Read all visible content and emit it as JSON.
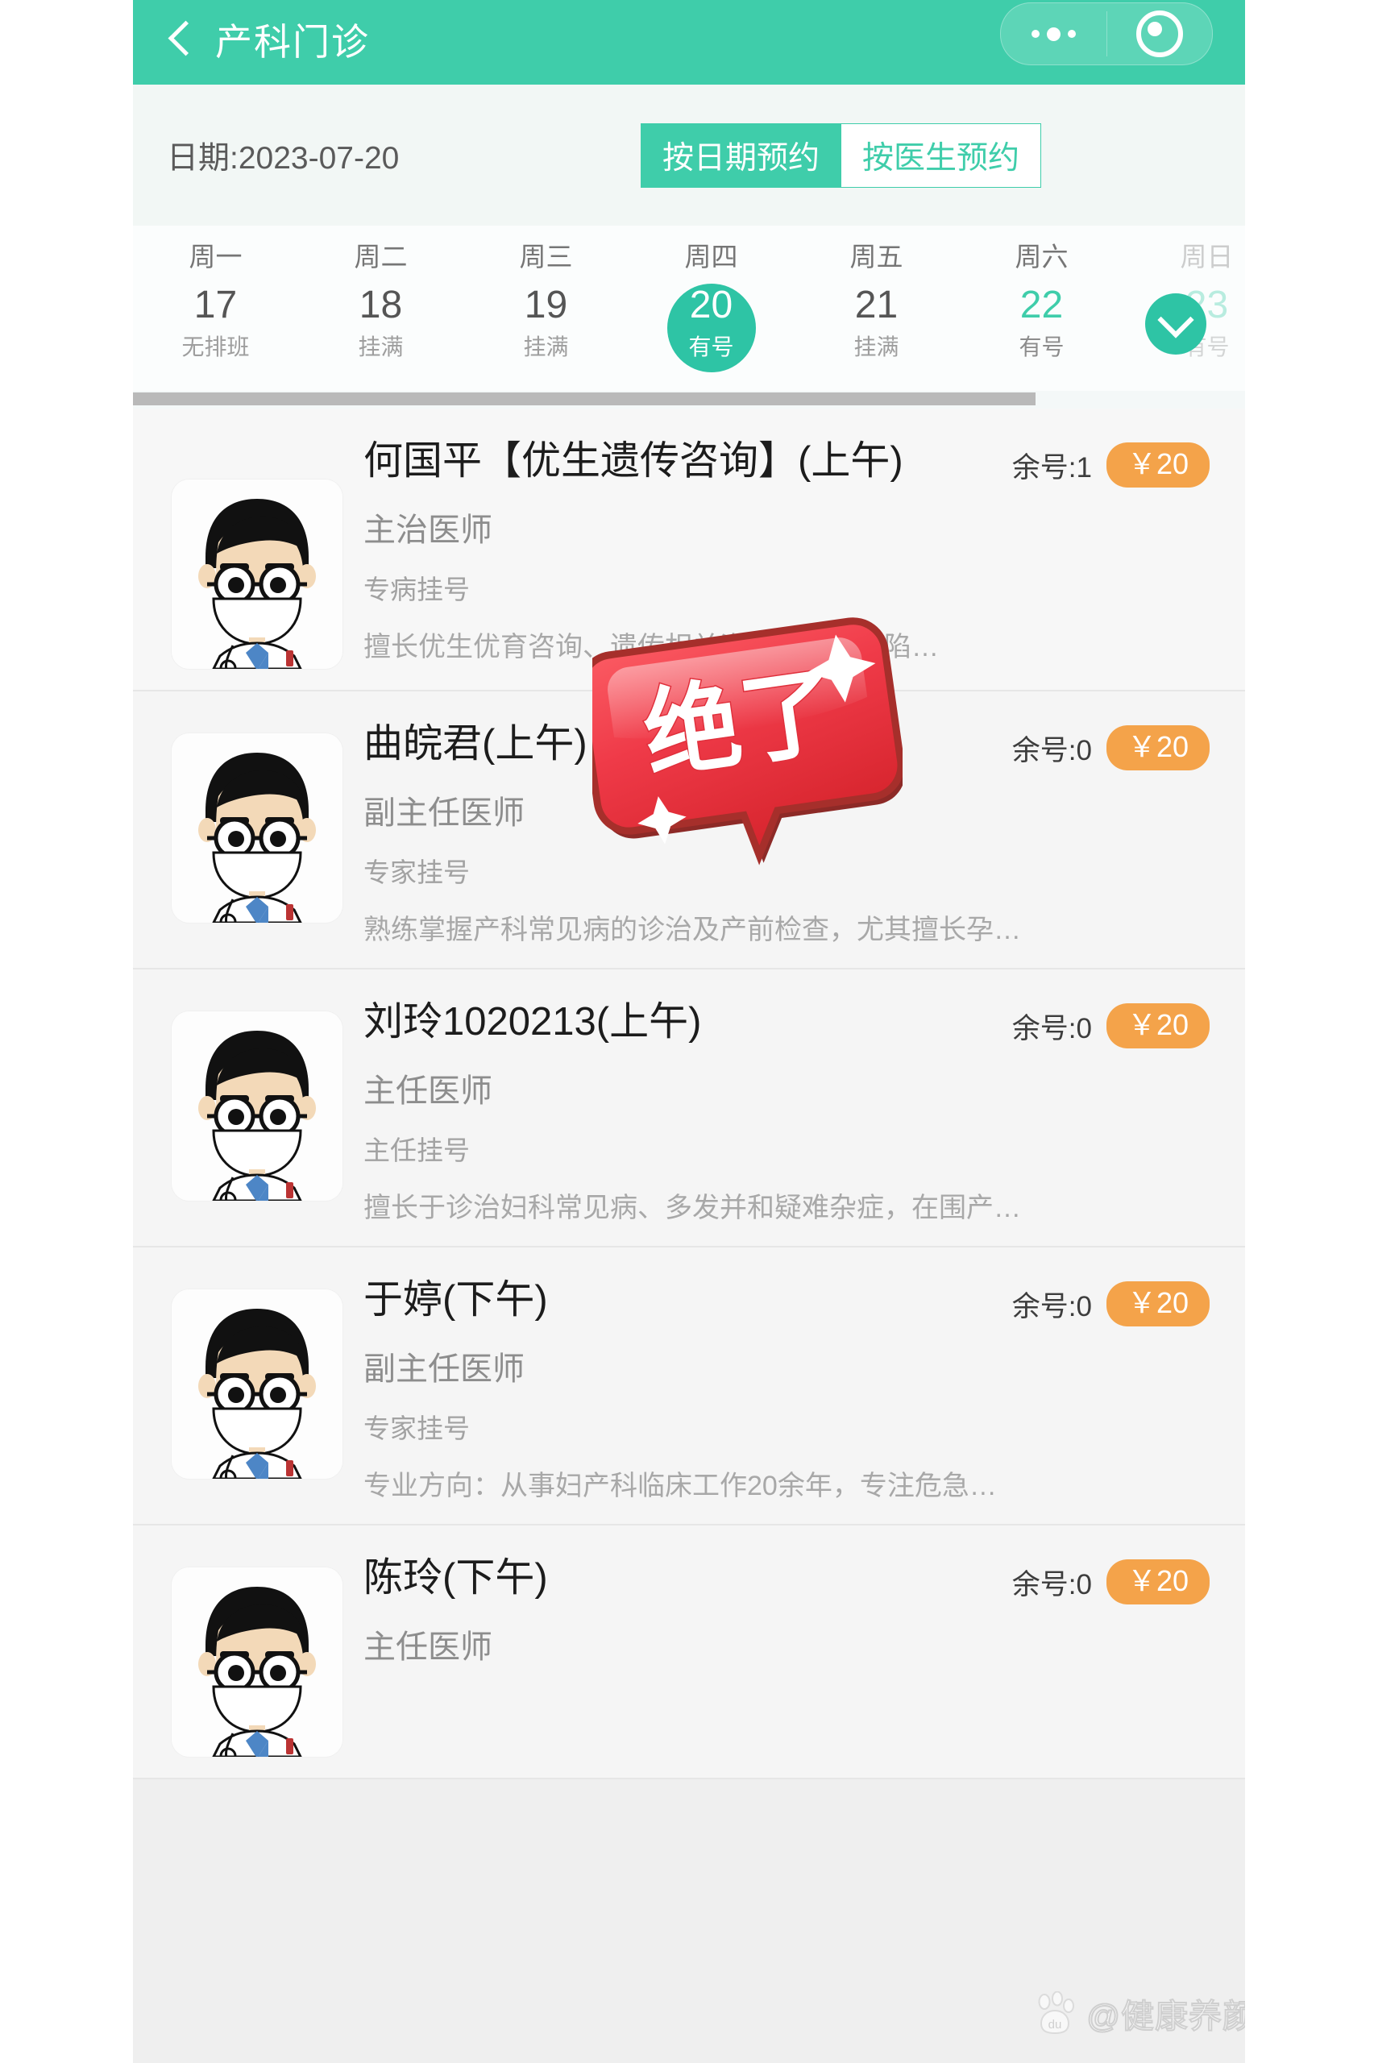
{
  "header": {
    "title": "产科门诊",
    "back_icon": "chevron-left-icon",
    "capsule": {
      "more_icon": "ellipsis-icon",
      "target_icon": "target-circle-icon"
    },
    "background_color": "#3fcdaa"
  },
  "datebar": {
    "date_label": "日期:2023-07-20",
    "segments": [
      {
        "label": "按日期预约",
        "active": true
      },
      {
        "label": "按医生预约",
        "active": false
      }
    ]
  },
  "weekstrip": {
    "expand_icon": "chevron-down-icon",
    "days": [
      {
        "dow": "周一",
        "num": "17",
        "status": "无排班",
        "selected": false,
        "available": false
      },
      {
        "dow": "周二",
        "num": "18",
        "status": "挂满",
        "selected": false,
        "available": false
      },
      {
        "dow": "周三",
        "num": "19",
        "status": "挂满",
        "selected": false,
        "available": false
      },
      {
        "dow": "周四",
        "num": "20",
        "status": "有号",
        "selected": true,
        "available": true
      },
      {
        "dow": "周五",
        "num": "21",
        "status": "挂满",
        "selected": false,
        "available": false
      },
      {
        "dow": "周六",
        "num": "22",
        "status": "有号",
        "selected": false,
        "available": true
      },
      {
        "dow": "周日",
        "num": "23",
        "status": "有号",
        "selected": false,
        "available": true
      }
    ]
  },
  "doctors": [
    {
      "name": "何国平【优生遗传咨询】(上午)",
      "title": "主治医师",
      "reg_type": "专病挂号",
      "remaining": "余号:1",
      "price": "￥20",
      "desc": "擅长优生优育咨询、遗传相关咨询、出生缺陷…",
      "avatar_icon": "doctor-avatar-icon"
    },
    {
      "name": "曲皖君(上午)",
      "title": "副主任医师",
      "reg_type": "专家挂号",
      "remaining": "余号:0",
      "price": "￥20",
      "desc": "熟练掌握产科常见病的诊治及产前检查，尤其擅长孕…",
      "avatar_icon": "doctor-avatar-icon"
    },
    {
      "name": "刘玲1020213(上午)",
      "title": "主任医师",
      "reg_type": "主任挂号",
      "remaining": "余号:0",
      "price": "￥20",
      "desc": "擅长于诊治妇科常见病、多发并和疑难杂症，在围产…",
      "avatar_icon": "doctor-avatar-icon"
    },
    {
      "name": "于婷(下午)",
      "title": "副主任医师",
      "reg_type": "专家挂号",
      "remaining": "余号:0",
      "price": "￥20",
      "desc": "专业方向：从事妇产科临床工作20余年，专注危急…",
      "avatar_icon": "doctor-avatar-icon"
    },
    {
      "name": "陈玲(下午)",
      "title": "主任医师",
      "reg_type": "",
      "remaining": "余号:0",
      "price": "￥20",
      "desc": "",
      "avatar_icon": "doctor-avatar-icon"
    }
  ],
  "sticker": {
    "text": "绝了",
    "color": "#ef3a48"
  },
  "watermark": {
    "text": "@健康养颜小贴士",
    "logo_icon": "baidu-paw-icon"
  },
  "colors": {
    "brand_green": "#3fcdaa",
    "selected_green": "#2ec4a5",
    "price_orange": "#f4a34a",
    "sticker_red": "#ef3a48"
  }
}
